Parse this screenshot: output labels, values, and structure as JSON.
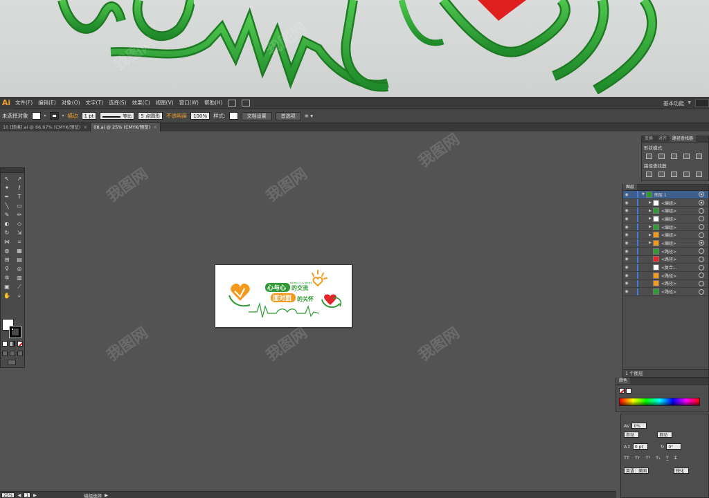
{
  "app": {
    "logo_text": "Ai",
    "menu": [
      "文件(F)",
      "编辑(E)",
      "对象(O)",
      "文字(T)",
      "选择(S)",
      "效果(C)",
      "视图(V)",
      "窗口(W)",
      "帮助(H)"
    ],
    "workspace": "基本功能"
  },
  "control_bar": {
    "selection": "未选择对象",
    "stroke_label": "描边",
    "stroke_weight": "1 pt",
    "stroke_profile": "等比",
    "brush": "5 点圆形",
    "opacity_label": "不透明度",
    "opacity_value": "100%",
    "style_label": "样式:",
    "doc_setup": "文档设置",
    "preferences": "首选项"
  },
  "tabs": [
    {
      "label": "10 [转换].ai @ 66.67% (CMYK/预览)",
      "active": false
    },
    {
      "label": "08.ai @ 25% (CMYK/预览)",
      "active": true
    }
  ],
  "artboard": {
    "title1": "心与心",
    "title2": "的交流",
    "title3": "面对面",
    "title4": "的关怀",
    "small_text": "倾听你的心声 关心你的成长",
    "accent_green": "#2e9b34",
    "accent_orange": "#f39a1e",
    "accent_red": "#e3262b"
  },
  "pathfinder": {
    "tabs": [
      "变换",
      "对齐",
      "路径查找器"
    ],
    "shape_modes_label": "形状模式:",
    "pathfinder_label": "路径查找器"
  },
  "layers": {
    "tab": "图层",
    "rows": [
      {
        "name": "图层 1",
        "expand": true
      },
      {
        "name": "<编组>",
        "expand": true
      },
      {
        "name": "<编组>",
        "expand": true
      },
      {
        "name": "<编组>",
        "expand": true
      },
      {
        "name": "<编组>",
        "expand": true
      },
      {
        "name": "<编组>",
        "expand": true
      },
      {
        "name": "<编组>",
        "expand": true
      },
      {
        "name": "<路径>",
        "expand": false
      },
      {
        "name": "<路径>",
        "expand": false
      },
      {
        "name": "<复合...",
        "expand": false
      },
      {
        "name": "<路径>",
        "expand": false
      },
      {
        "name": "<路径>",
        "expand": false
      },
      {
        "name": "<路径>",
        "expand": false
      }
    ],
    "footer": "1 个图层"
  },
  "color_panel": {
    "tab": "颜色"
  },
  "character": {
    "tracking": "0%",
    "leading_left": "自动",
    "leading_right": "自动",
    "baseline": "0 pt",
    "rotation": "0°",
    "language": "英语：美国",
    "antialias": "锐化"
  },
  "status": {
    "zoom": "25%",
    "page": "1",
    "tool": "编组选择"
  },
  "watermark": "我图网"
}
